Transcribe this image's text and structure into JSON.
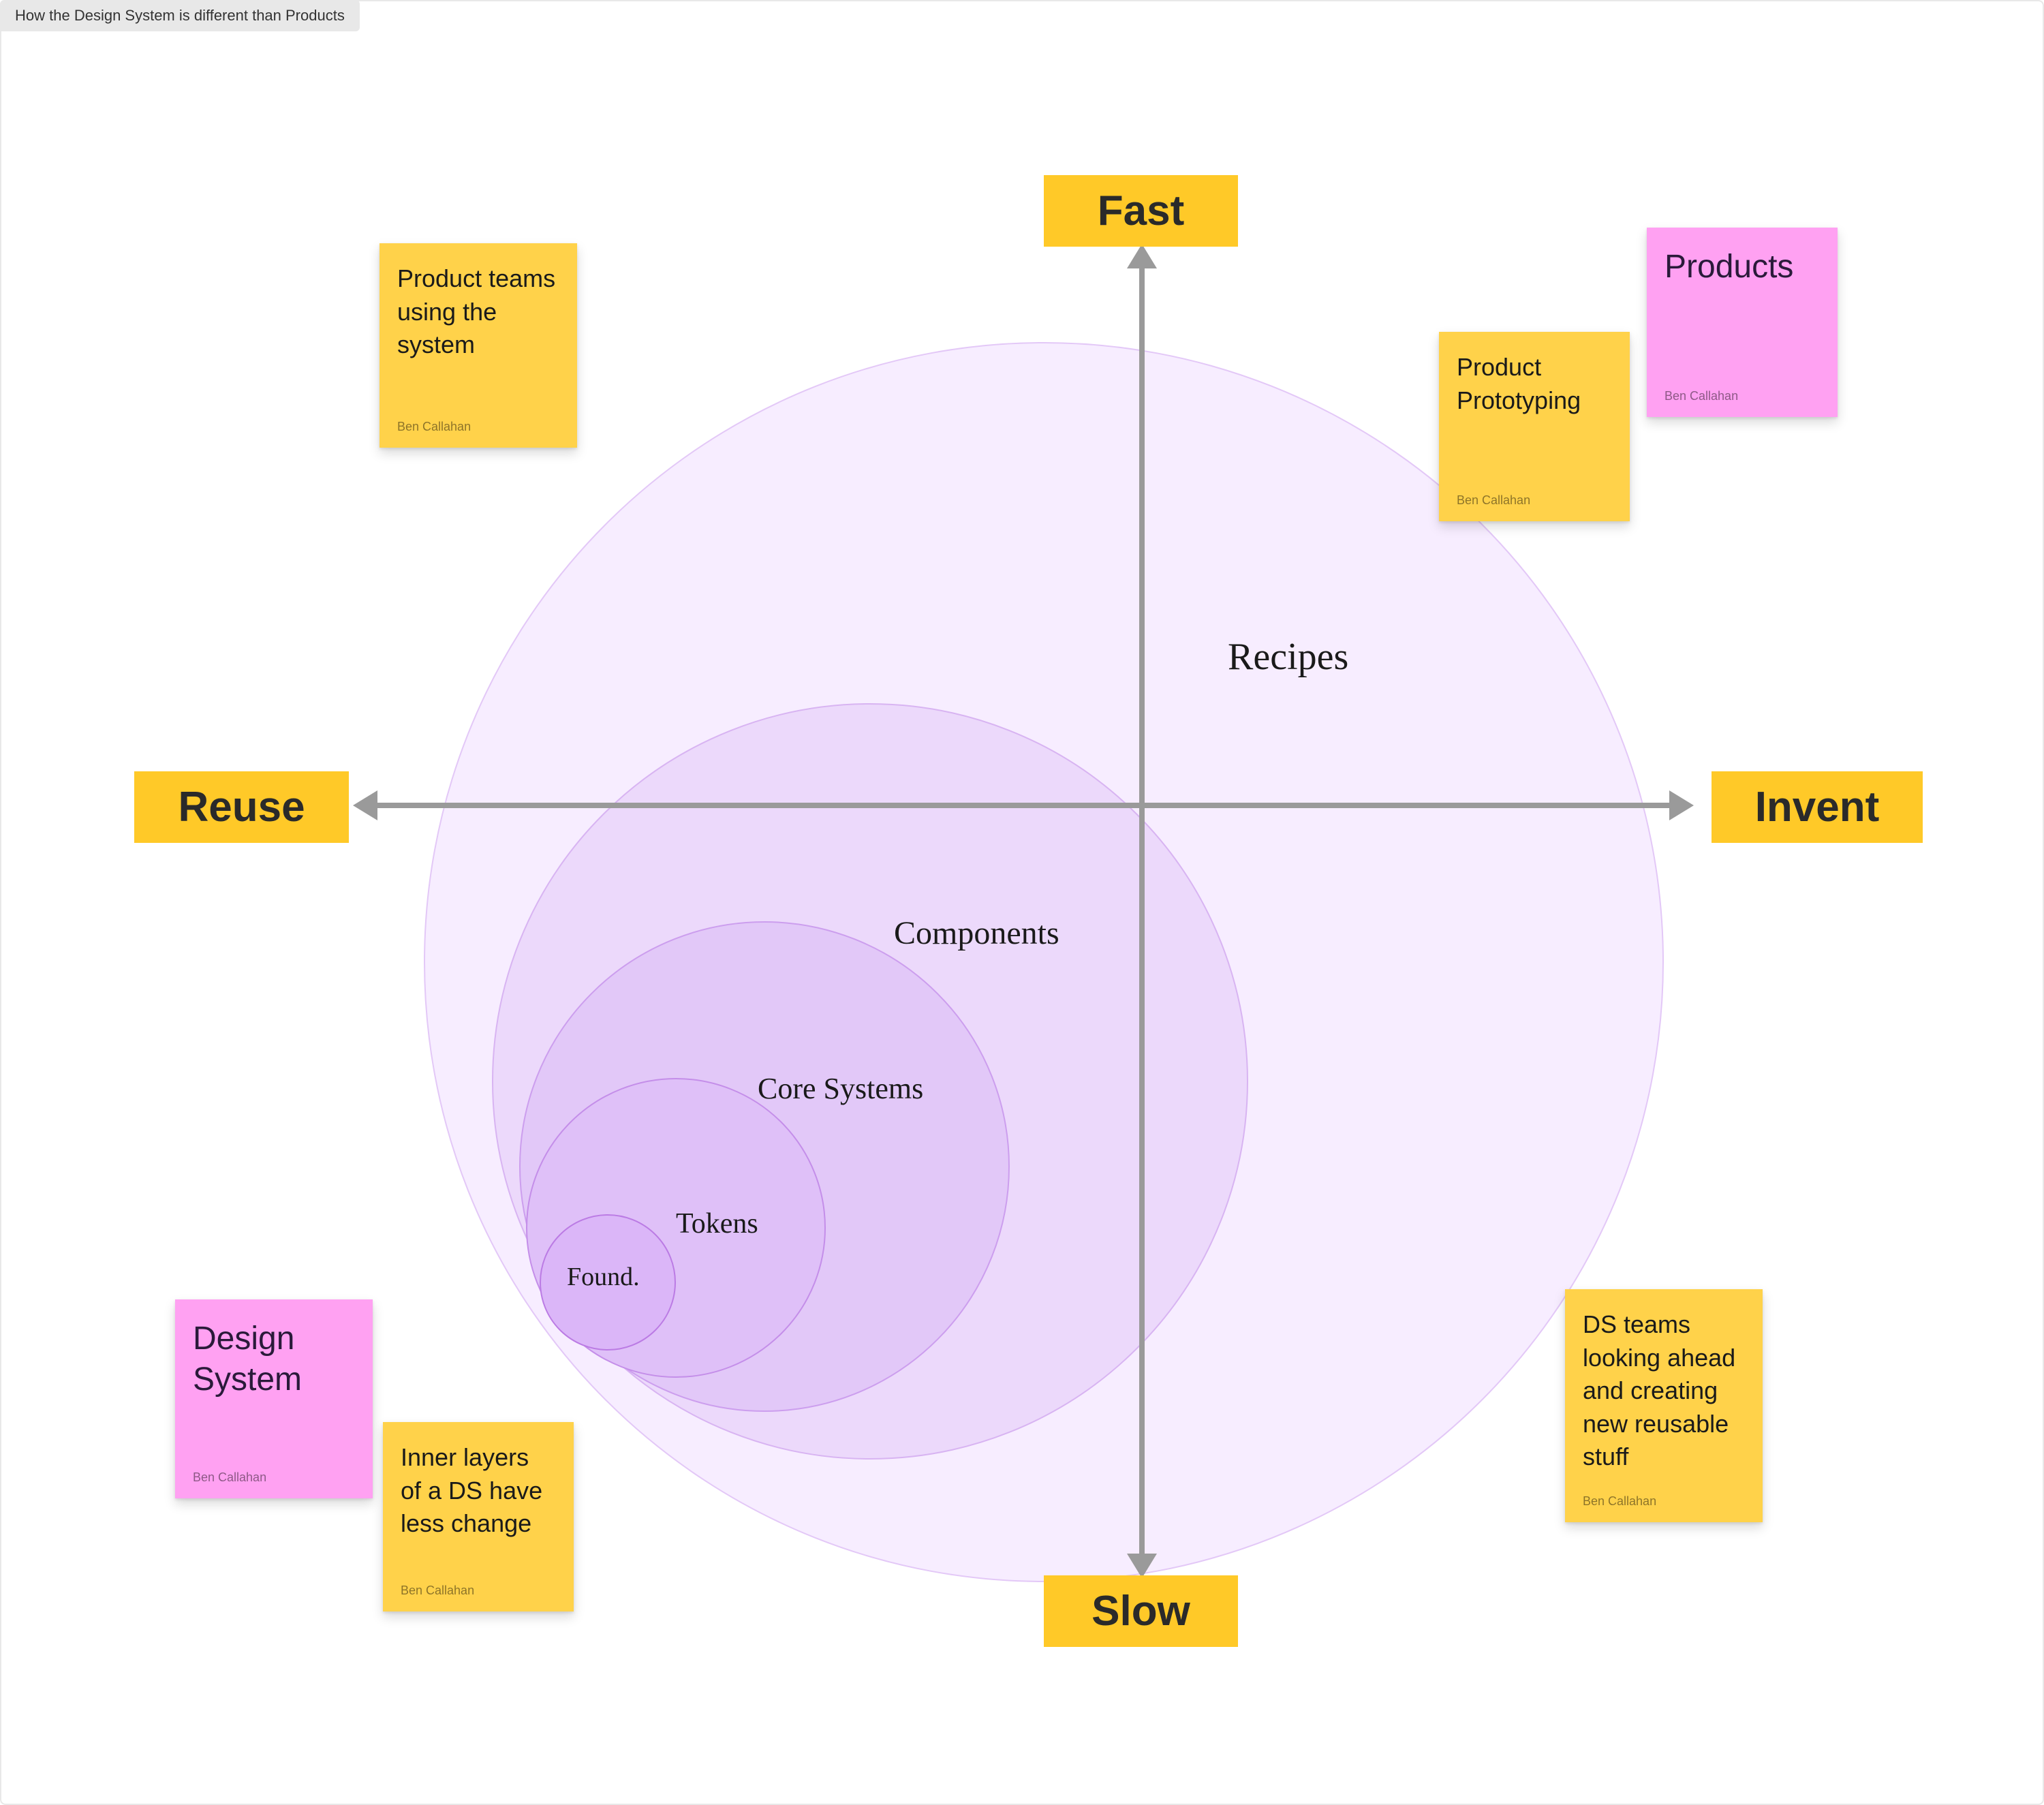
{
  "title": "How the Design System is different than Products",
  "axes": {
    "top": "Fast",
    "bottom": "Slow",
    "left": "Reuse",
    "right": "Invent"
  },
  "circles": {
    "recipes": "Recipes",
    "components": "Components",
    "core_systems": "Core Systems",
    "tokens": "Tokens",
    "foundations": "Found."
  },
  "stickies": {
    "product_teams": {
      "text": "Product teams using the system",
      "author": "Ben Callahan"
    },
    "product_prototyping": {
      "text": "Product Prototyping",
      "author": "Ben Callahan"
    },
    "products": {
      "text": "Products",
      "author": "Ben Callahan"
    },
    "design_system": {
      "text": "Design System",
      "author": "Ben Callahan"
    },
    "inner_layers": {
      "text": "Inner layers of a DS have less change",
      "author": "Ben Callahan"
    },
    "ds_teams": {
      "text": "DS teams looking ahead and creating new reusable stuff",
      "author": "Ben Callahan"
    }
  }
}
